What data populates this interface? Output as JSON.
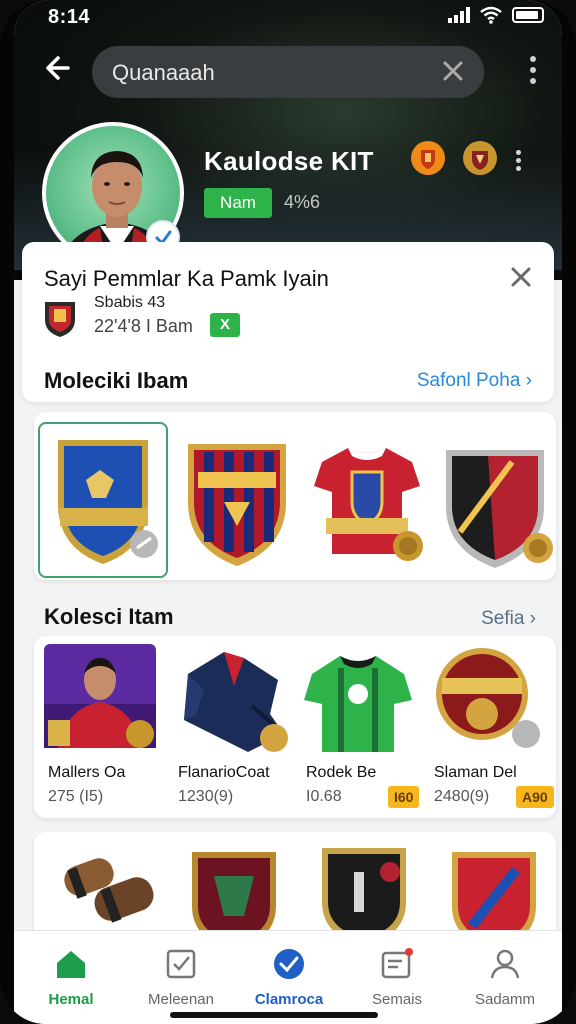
{
  "status_bar": {
    "time": "8:14"
  },
  "search": {
    "query": "Quanaaah"
  },
  "profile": {
    "name": "Kaulodse KIT",
    "status_pill": "Nam",
    "count": "4%6"
  },
  "info_card": {
    "title": "Sayi Pemmlar Ka Pamk Iyain",
    "subtitle": "Sbabis 43",
    "stats": "22'4'8 I Bam",
    "tag": "X"
  },
  "section_badges": {
    "title": "Moleciki Ibam",
    "link": "Safonl Poha"
  },
  "section_items": {
    "title": "Kolesci Itam",
    "link": "Sefia",
    "items": [
      {
        "name": "Mallers Oa",
        "meta": "275 (I5)",
        "price": ""
      },
      {
        "name": "FlanarioCoat",
        "meta": "1230(9)",
        "price": ""
      },
      {
        "name": "Rodek Be",
        "meta": "I0.68",
        "price": "I60"
      },
      {
        "name": "Slaman Del",
        "meta": "2480(9)",
        "price": "A90"
      }
    ]
  },
  "bottom_nav": [
    {
      "label": "Hemal"
    },
    {
      "label": "Meleenan"
    },
    {
      "label": "Clamroca"
    },
    {
      "label": "Semais"
    },
    {
      "label": "Sadamm"
    }
  ],
  "colors": {
    "accent_green": "#2db34a",
    "accent_blue": "#1f5fc6",
    "link_blue": "#2a8ad6"
  },
  "icons": [
    "back-arrow-icon",
    "close-icon",
    "more-vertical-icon",
    "shield-icon",
    "crest-icon",
    "home-icon",
    "checklist-icon",
    "check-circle-icon",
    "notification-icon",
    "profile-icon"
  ]
}
